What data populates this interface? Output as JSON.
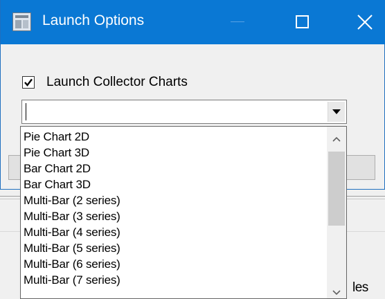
{
  "window": {
    "title": "Launch Options"
  },
  "checkbox": {
    "label": "Launch Collector Charts",
    "checked": true
  },
  "combo": {
    "value": ""
  },
  "dropdown": {
    "items": [
      "Pie Chart 2D",
      "Pie Chart 3D",
      "Bar Chart 2D",
      "Bar Chart 3D",
      "Multi-Bar (2 series)",
      "Multi-Bar (3 series)",
      "Multi-Bar (4 series)",
      "Multi-Bar (5 series)",
      "Multi-Bar (6 series)",
      "Multi-Bar (7 series)"
    ]
  },
  "background": {
    "partial_text": "les"
  },
  "colors": {
    "titlebar": "#0a78d4",
    "dialog_background": "#f0f0f0",
    "scroll_thumb": "#cdcdcd"
  }
}
